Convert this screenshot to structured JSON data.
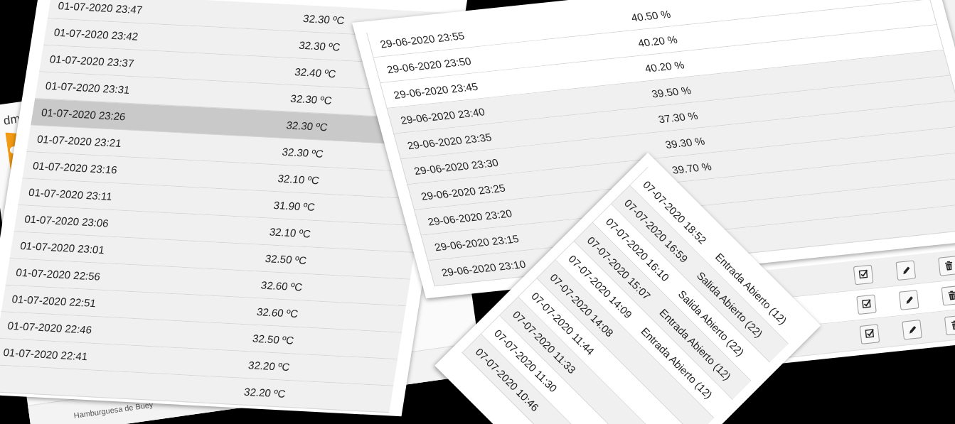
{
  "admin_panel": {
    "header_text": "dm",
    "footer_text": "Hamburguesa de Buey"
  },
  "temperature_table": {
    "rows": [
      {
        "timestamp": "01-07-2020 23:47",
        "value": "32.30 ºC",
        "selected": false
      },
      {
        "timestamp": "01-07-2020 23:42",
        "value": "32.30 ºC",
        "selected": false
      },
      {
        "timestamp": "01-07-2020 23:37",
        "value": "32.40 ºC",
        "selected": false
      },
      {
        "timestamp": "01-07-2020 23:31",
        "value": "32.30 ºC",
        "selected": false
      },
      {
        "timestamp": "01-07-2020 23:26",
        "value": "32.30 ºC",
        "selected": true
      },
      {
        "timestamp": "01-07-2020 23:21",
        "value": "32.30 ºC",
        "selected": false
      },
      {
        "timestamp": "01-07-2020 23:16",
        "value": "32.10 ºC",
        "selected": false
      },
      {
        "timestamp": "01-07-2020 23:11",
        "value": "31.90 ºC",
        "selected": false
      },
      {
        "timestamp": "01-07-2020 23:06",
        "value": "32.10 ºC",
        "selected": false
      },
      {
        "timestamp": "01-07-2020 23:01",
        "value": "32.50 ºC",
        "selected": false
      },
      {
        "timestamp": "01-07-2020 22:56",
        "value": "32.60 ºC",
        "selected": false
      },
      {
        "timestamp": "01-07-2020 22:51",
        "value": "32.60 ºC",
        "selected": false
      },
      {
        "timestamp": "01-07-2020 22:46",
        "value": "32.50 ºC",
        "selected": false
      },
      {
        "timestamp": "01-07-2020 22:41",
        "value": "32.20 ºC",
        "selected": false
      },
      {
        "value": "32.20 ºC",
        "selected": false
      }
    ]
  },
  "actions_table": {
    "rows": [
      {
        "actions": [
          {
            "kind": "check"
          },
          {
            "kind": "edit"
          },
          {
            "kind": "delete"
          }
        ]
      },
      {
        "actions": [
          {
            "kind": "check"
          },
          {
            "kind": "edit"
          },
          {
            "kind": "delete"
          }
        ]
      },
      {
        "actions": [
          {
            "kind": "check"
          },
          {
            "kind": "edit"
          },
          {
            "kind": "delete"
          }
        ]
      }
    ]
  },
  "humidity_table": {
    "rows": [
      {
        "timestamp": "29-06-2020 23:55",
        "value": "40.50 %"
      },
      {
        "timestamp": "29-06-2020 23:50",
        "value": "40.20 %"
      },
      {
        "timestamp": "29-06-2020 23:45",
        "value": "40.20 %"
      },
      {
        "timestamp": "29-06-2020 23:40",
        "value": "39.50 %"
      },
      {
        "timestamp": "29-06-2020 23:35",
        "value": "37.30 %"
      },
      {
        "timestamp": "29-06-2020 23:30",
        "value": "39.30 %"
      },
      {
        "timestamp": "29-06-2020 23:25",
        "value": "39.70 %"
      },
      {
        "timestamp": "29-06-2020 23:20"
      },
      {
        "timestamp": "29-06-2020 23:15"
      },
      {
        "timestamp": "29-06-2020 23:10"
      }
    ]
  },
  "events_table": {
    "rows": [
      {
        "timestamp": "07-07-2020 18:52",
        "event": "Entrada Abierto (12)"
      },
      {
        "timestamp": "07-07-2020 16:59",
        "event": "Salida Abierto (22)"
      },
      {
        "timestamp": "07-07-2020 16:10",
        "event": "Salida Abierto (22)"
      },
      {
        "timestamp": "07-07-2020 15:07",
        "event": "Entrada Abierto (12)"
      },
      {
        "timestamp": "07-07-2020 14:09",
        "event": "Entrada Abierto (12)"
      },
      {
        "timestamp": "07-07-2020 14:08"
      },
      {
        "timestamp": "07-07-2020 11:44"
      },
      {
        "timestamp": "07-07-2020 11:33"
      },
      {
        "timestamp": "07-07-2020 11:30"
      },
      {
        "timestamp": "07-07-2020 10:46"
      }
    ]
  }
}
